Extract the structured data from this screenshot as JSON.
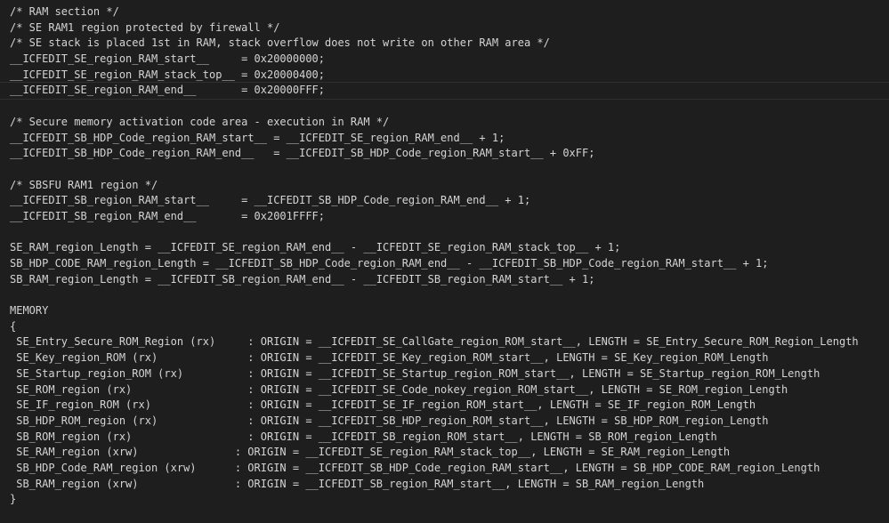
{
  "editor": {
    "current_line": 5,
    "lines": [
      "/* RAM section */",
      "/* SE RAM1 region protected by firewall */",
      "/* SE stack is placed 1st in RAM, stack overflow does not write on other RAM area */",
      "__ICFEDIT_SE_region_RAM_start__     = 0x20000000;",
      "__ICFEDIT_SE_region_RAM_stack_top__ = 0x20000400;",
      "__ICFEDIT_SE_region_RAM_end__       = 0x20000FFF;",
      "",
      "/* Secure memory activation code area - execution in RAM */",
      "__ICFEDIT_SB_HDP_Code_region_RAM_start__ = __ICFEDIT_SE_region_RAM_end__ + 1;",
      "__ICFEDIT_SB_HDP_Code_region_RAM_end__   = __ICFEDIT_SB_HDP_Code_region_RAM_start__ + 0xFF;",
      "",
      "/* SBSFU RAM1 region */",
      "__ICFEDIT_SB_region_RAM_start__     = __ICFEDIT_SB_HDP_Code_region_RAM_end__ + 1;",
      "__ICFEDIT_SB_region_RAM_end__       = 0x2001FFFF;",
      "",
      "SE_RAM_region_Length = __ICFEDIT_SE_region_RAM_end__ - __ICFEDIT_SE_region_RAM_stack_top__ + 1;",
      "SB_HDP_CODE_RAM_region_Length = __ICFEDIT_SB_HDP_Code_region_RAM_end__ - __ICFEDIT_SB_HDP_Code_region_RAM_start__ + 1;",
      "SB_RAM_region_Length = __ICFEDIT_SB_region_RAM_end__ - __ICFEDIT_SB_region_RAM_start__ + 1;",
      "",
      "MEMORY",
      "{",
      " SE_Entry_Secure_ROM_Region (rx)     : ORIGIN = __ICFEDIT_SE_CallGate_region_ROM_start__, LENGTH = SE_Entry_Secure_ROM_Region_Length",
      " SE_Key_region_ROM (rx)              : ORIGIN = __ICFEDIT_SE_Key_region_ROM_start__, LENGTH = SE_Key_region_ROM_Length",
      " SE_Startup_region_ROM (rx)          : ORIGIN = __ICFEDIT_SE_Startup_region_ROM_start__, LENGTH = SE_Startup_region_ROM_Length",
      " SE_ROM_region (rx)                  : ORIGIN = __ICFEDIT_SE_Code_nokey_region_ROM_start__, LENGTH = SE_ROM_region_Length",
      " SE_IF_region_ROM (rx)               : ORIGIN = __ICFEDIT_SE_IF_region_ROM_start__, LENGTH = SE_IF_region_ROM_Length",
      " SB_HDP_ROM_region (rx)              : ORIGIN = __ICFEDIT_SB_HDP_region_ROM_start__, LENGTH = SB_HDP_ROM_region_Length",
      " SB_ROM_region (rx)                  : ORIGIN = __ICFEDIT_SB_region_ROM_start__, LENGTH = SB_ROM_region_Length",
      " SE_RAM_region (xrw)               : ORIGIN = __ICFEDIT_SE_region_RAM_stack_top__, LENGTH = SE_RAM_region_Length",
      " SB_HDP_Code_RAM_region (xrw)      : ORIGIN = __ICFEDIT_SB_HDP_Code_region_RAM_start__, LENGTH = SB_HDP_CODE_RAM_region_Length",
      " SB_RAM_region (xrw)               : ORIGIN = __ICFEDIT_SB_region_RAM_start__, LENGTH = SB_RAM_region_Length",
      "}"
    ]
  }
}
